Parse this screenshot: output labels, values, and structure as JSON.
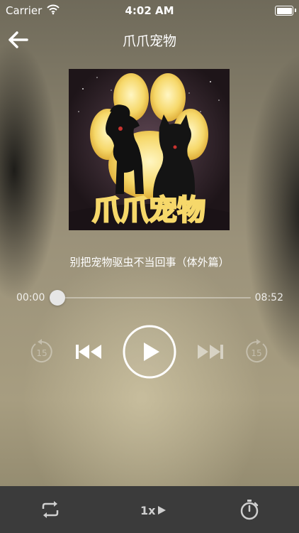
{
  "status_bar": {
    "carrier": "Carrier",
    "time": "4:02 AM",
    "icons": [
      "wifi-icon",
      "battery-icon"
    ]
  },
  "nav": {
    "title": "爪爪宠物",
    "back_icon": "arrow-left-icon"
  },
  "cover": {
    "logo_text": "爪爪宠物"
  },
  "track": {
    "title": "别把宠物驱虫不当回事（体外篇）"
  },
  "progress": {
    "current": "00:00",
    "total": "08:52",
    "fraction": 0.0
  },
  "controls": {
    "skip_back": "15",
    "skip_forward": "15",
    "icons": [
      "rewind-15-icon",
      "previous-icon",
      "play-icon",
      "next-icon",
      "forward-15-icon"
    ]
  },
  "bottom_bar": {
    "speed_label": "1x",
    "icons": [
      "repeat-icon",
      "play-arrow-icon",
      "timer-icon"
    ]
  },
  "colors": {
    "bottom_bar_bg": "#3b3b3b",
    "logo_glow": "#f6d86a"
  }
}
